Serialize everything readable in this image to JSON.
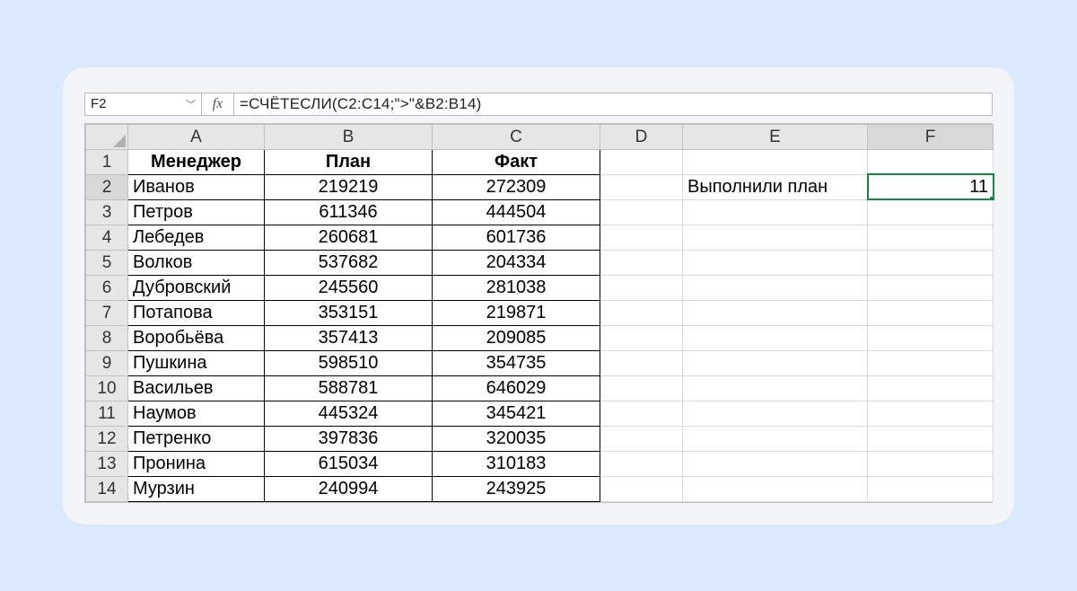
{
  "name_box": "F2",
  "fx_label": "fx",
  "formula": "=СЧЁТЕСЛИ(C2:C14;\">\"&B2:B14)",
  "columns": [
    "A",
    "B",
    "C",
    "D",
    "E",
    "F"
  ],
  "row_numbers": [
    "1",
    "2",
    "3",
    "4",
    "5",
    "6",
    "7",
    "8",
    "9",
    "10",
    "11",
    "12",
    "13",
    "14"
  ],
  "headers": {
    "A": "Менеджер",
    "B": "План",
    "C": "Факт"
  },
  "data_rows": [
    {
      "manager": "Иванов",
      "plan": "219219",
      "fact": "272309"
    },
    {
      "manager": "Петров",
      "plan": "611346",
      "fact": "444504"
    },
    {
      "manager": "Лебедев",
      "plan": "260681",
      "fact": "601736"
    },
    {
      "manager": "Волков",
      "plan": "537682",
      "fact": "204334"
    },
    {
      "manager": "Дубровский",
      "plan": "245560",
      "fact": "281038"
    },
    {
      "manager": "Потапова",
      "plan": "353151",
      "fact": "219871"
    },
    {
      "manager": "Воробьёва",
      "plan": "357413",
      "fact": "209085"
    },
    {
      "manager": "Пушкина",
      "plan": "598510",
      "fact": "354735"
    },
    {
      "manager": "Васильев",
      "plan": "588781",
      "fact": "646029"
    },
    {
      "manager": "Наумов",
      "plan": "445324",
      "fact": "345421"
    },
    {
      "manager": "Петренко",
      "plan": "397836",
      "fact": "320035"
    },
    {
      "manager": "Пронина",
      "plan": "615034",
      "fact": "310183"
    },
    {
      "manager": "Мурзин",
      "plan": "240994",
      "fact": "243925"
    }
  ],
  "e2_label": "Выполнили план",
  "f2_value": "11",
  "selected_cell": "F2"
}
